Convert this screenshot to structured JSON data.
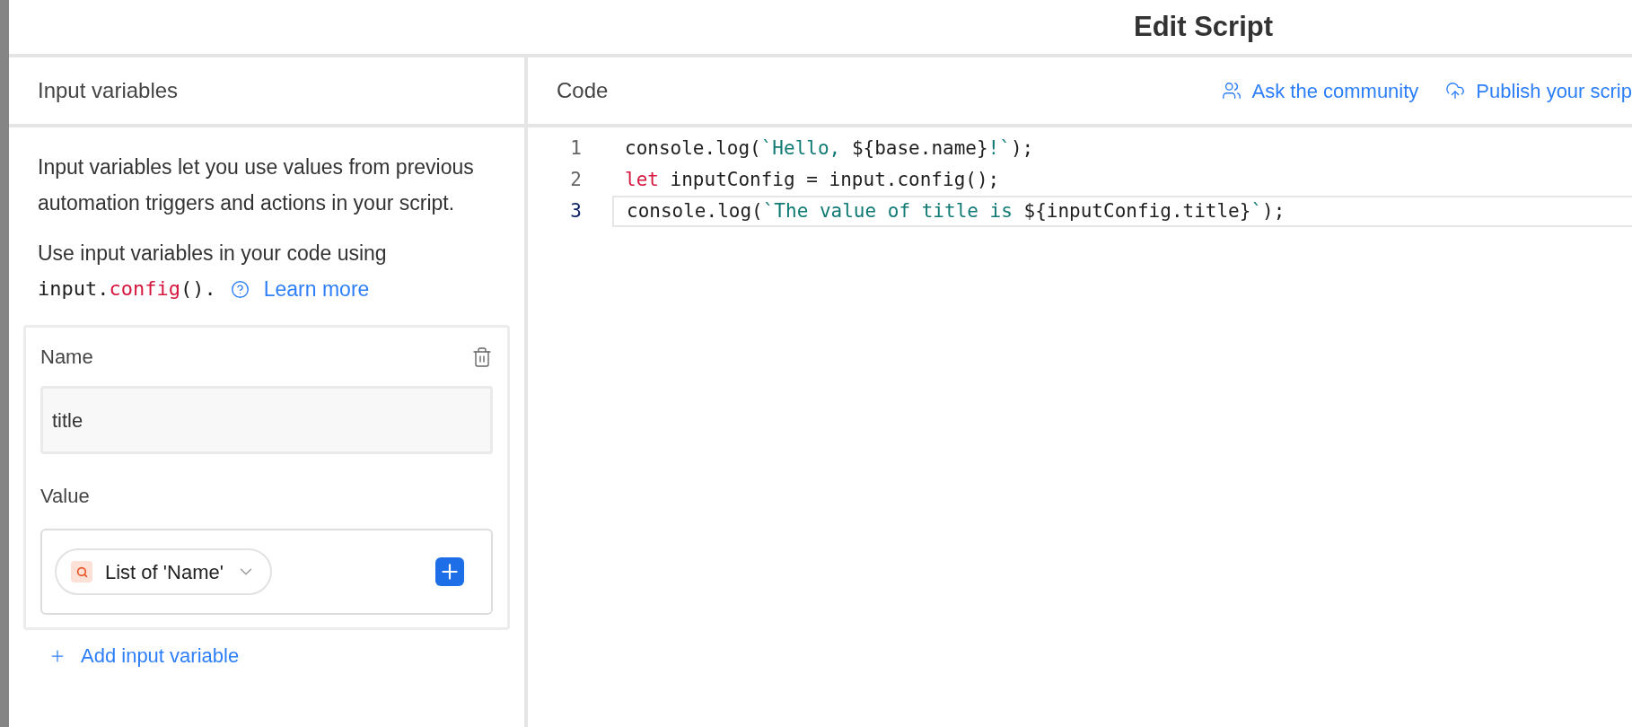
{
  "window": {
    "title": "Edit Script"
  },
  "input_panel": {
    "title": "Input variables",
    "description": "Input variables let you use values from previous automation triggers and actions in your script.",
    "usage": {
      "text": "Use input variables in your code using",
      "code": [
        {
          "kind": "plain",
          "text": "input."
        },
        {
          "kind": "keyword",
          "text": "config"
        },
        {
          "kind": "plain",
          "text": "()."
        }
      ],
      "link": "Learn more"
    },
    "variable": {
      "name_label": "Name",
      "name_value": "title",
      "value_label": "Value",
      "value_token": "List of 'Name'"
    },
    "add_button": "Add input variable"
  },
  "code_panel": {
    "title": "Code",
    "actions": [
      "Ask the community",
      "Publish your scrip"
    ],
    "lines": [
      {
        "number": "1",
        "selected": false,
        "tokens": [
          {
            "kind": "plain",
            "text": "console.log("
          },
          {
            "kind": "string",
            "text": "`Hello, "
          },
          {
            "kind": "plain",
            "text": "${base.name}"
          },
          {
            "kind": "string",
            "text": "!`"
          },
          {
            "kind": "plain",
            "text": ");"
          }
        ]
      },
      {
        "number": "2",
        "selected": false,
        "tokens": [
          {
            "kind": "keyword",
            "text": "let"
          },
          {
            "kind": "plain",
            "text": " inputConfig = input.config();"
          }
        ]
      },
      {
        "number": "3",
        "selected": true,
        "tokens": [
          {
            "kind": "plain",
            "text": "console.log("
          },
          {
            "kind": "string",
            "text": "`The value of title is "
          },
          {
            "kind": "plain",
            "text": "${inputConfig.title}"
          },
          {
            "kind": "string",
            "text": "`"
          },
          {
            "kind": "plain",
            "text": ");"
          }
        ]
      }
    ]
  }
}
